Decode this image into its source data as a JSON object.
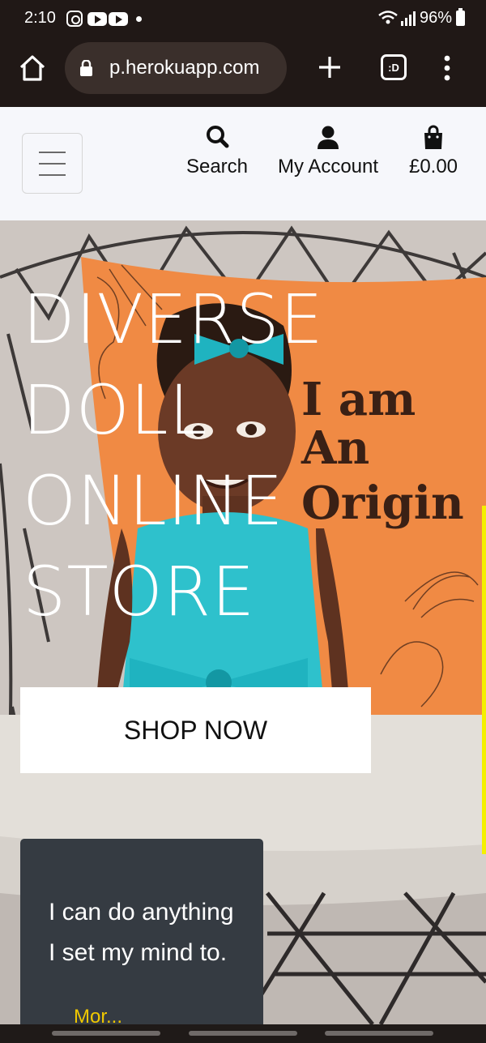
{
  "status_bar": {
    "time": "2:10",
    "battery": "96%",
    "icons": [
      "instagram-icon",
      "youtube-icon",
      "youtube-icon",
      "notification-dot-icon",
      "wifi-icon",
      "signal-icon",
      "battery-icon"
    ]
  },
  "browser": {
    "url": "p.herokuapp.com",
    "tabs_label": ":D",
    "icons": [
      "home-icon",
      "lock-icon",
      "plus-icon",
      "tabs-icon",
      "more-vert-icon"
    ]
  },
  "header": {
    "nav": [
      {
        "label": "Search",
        "icon": "search-icon"
      },
      {
        "label": "My Account",
        "icon": "user-icon"
      },
      {
        "label": "£0.00",
        "icon": "shopping-bag-icon"
      }
    ]
  },
  "hero": {
    "title": "DIVERSE\nDOLL\nONLINE\nSTORE",
    "pillow_text": "I am\nAn\nOrigin",
    "cta": "SHOP NOW"
  },
  "quote": {
    "text": "I can do anything I set my mind to.",
    "link_partial": "Mor..."
  },
  "colors": {
    "header_bg": "#f6f7fb",
    "browser_bg": "#201816",
    "card_bg": "#353b42",
    "pillow": "#f08a44",
    "accent_yellow": "#f4f000"
  }
}
